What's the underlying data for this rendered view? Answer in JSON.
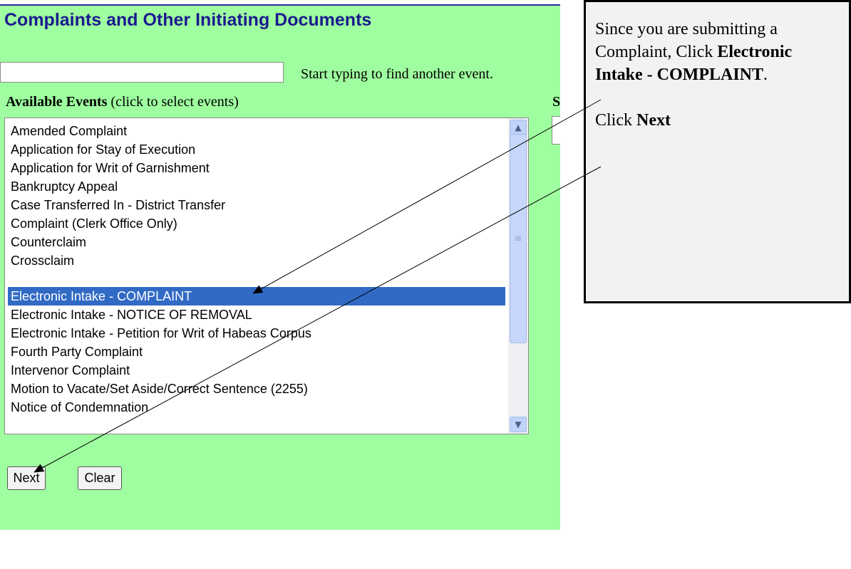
{
  "page": {
    "title": "Complaints and Other Initiating Documents",
    "search_hint": "Start typing to find another event.",
    "available_label_bold": "Available Events",
    "available_label_rest": " (click to select events)",
    "selected_label_partial": "S"
  },
  "listbox": {
    "items": [
      {
        "label": "Amended Complaint"
      },
      {
        "label": "Application for Stay of Execution"
      },
      {
        "label": "Application for Writ of Garnishment"
      },
      {
        "label": "Bankruptcy Appeal"
      },
      {
        "label": "Case Transferred In - District Transfer"
      },
      {
        "label": "Complaint (Clerk Office Only)"
      },
      {
        "label": "Counterclaim"
      },
      {
        "label": "Crossclaim"
      },
      {
        "label": "Electronic Intake - COMPLAINT",
        "selected": true
      },
      {
        "label": "Electronic Intake - NOTICE OF REMOVAL"
      },
      {
        "label": "Electronic Intake - Petition for Writ of Habeas Corpus"
      },
      {
        "label": "Fourth Party Complaint"
      },
      {
        "label": "Intervenor Complaint"
      },
      {
        "label": "Motion to Vacate/Set Aside/Correct Sentence (2255)"
      },
      {
        "label": "Notice of Condemnation"
      }
    ],
    "scroll_up_icon": "chevron-up-icon",
    "scroll_down_icon": "chevron-down-icon",
    "colors": {
      "selected_bg": "#316ac5",
      "selected_fg": "#ffffff"
    }
  },
  "buttons": {
    "next_label": "Next",
    "clear_label": "Clear"
  },
  "callout": {
    "line1": "Since you are submitting a Complaint, Click",
    "bold1": "Electronic Intake - COMPLAINT",
    "after_bold1": ".",
    "line2_prefix": "Click ",
    "bold2": "Next"
  },
  "colors": {
    "page_bg": "#9ffe9f",
    "title": "#1b1b8f",
    "callout_bg": "#f2f2f2"
  }
}
